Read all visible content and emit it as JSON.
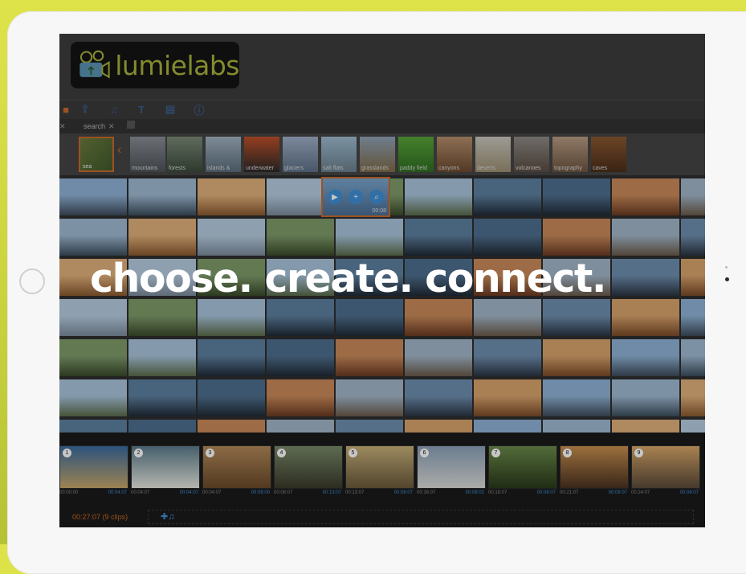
{
  "brand": {
    "name": "lumielabs"
  },
  "tagline": "choose. create. connect.",
  "toolbar": {
    "icons": [
      "upload-icon",
      "music-icon",
      "text-icon",
      "document-icon",
      "info-icon"
    ]
  },
  "tabs": [
    {
      "label": "search"
    }
  ],
  "categories": [
    {
      "label": "mountains"
    },
    {
      "label": "forests"
    },
    {
      "label": "islands &"
    },
    {
      "label": "underwater"
    },
    {
      "label": "glaciers"
    },
    {
      "label": "salt flats"
    },
    {
      "label": "grasslands"
    },
    {
      "label": "paddy field"
    },
    {
      "label": "canyons"
    },
    {
      "label": "deserts"
    },
    {
      "label": "volcanoes"
    },
    {
      "label": "topography"
    },
    {
      "label": "caves"
    }
  ],
  "selected_category_label": "sea",
  "hover_card": {
    "time": "00:08"
  },
  "timeline": {
    "total_label": "00:27:07",
    "clip_count_label": "(9 clips)",
    "clips": [
      {
        "num": "1",
        "start": "00:00:00",
        "end": "00:04:07"
      },
      {
        "num": "2",
        "start": "00:04:07",
        "end": "00:04:07"
      },
      {
        "num": "3",
        "start": "00:04:07",
        "end": "00:08:00"
      },
      {
        "num": "4",
        "start": "00:08:07",
        "end": "00:13:07"
      },
      {
        "num": "5",
        "start": "00:13:07",
        "end": "00:08:07"
      },
      {
        "num": "6",
        "start": "00:16:07",
        "end": "00:08:02"
      },
      {
        "num": "7",
        "start": "00:18:07",
        "end": "00:08:07"
      },
      {
        "num": "8",
        "start": "00:21:07",
        "end": "00:08:07"
      },
      {
        "num": "9",
        "start": "00:24:07",
        "end": "00:08:07"
      }
    ]
  },
  "colors": {
    "accent_orange": "#c86a2c",
    "accent_blue": "#3f8fd6",
    "logo_green": "#a9b23a",
    "background_yellow": "#dfe34a"
  }
}
